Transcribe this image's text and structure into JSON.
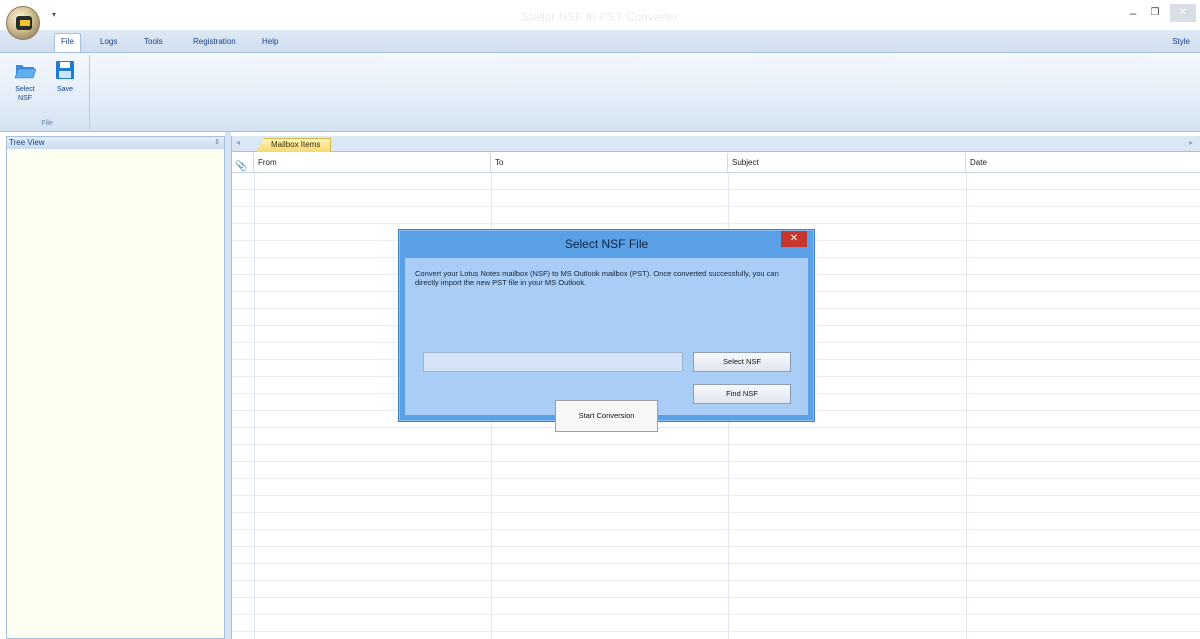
{
  "window": {
    "title": "Stellar NSF to PST Converter",
    "minimize_glyph": "–",
    "maximize_glyph": "❐",
    "close_glyph": "✕",
    "qat_glyph": "▾"
  },
  "ribbon": {
    "tabs": [
      {
        "label": "File",
        "active": true
      },
      {
        "label": "Logs",
        "active": false
      },
      {
        "label": "Tools",
        "active": false
      },
      {
        "label": "Registration",
        "active": false
      },
      {
        "label": "Help",
        "active": false
      }
    ],
    "style_label": "Style",
    "groups": [
      {
        "label": "File",
        "buttons": [
          {
            "label": "Select NSF",
            "icon": "folder-open-icon"
          },
          {
            "label": "Save",
            "icon": "floppy-disk-icon"
          }
        ]
      }
    ]
  },
  "tree_view": {
    "title": "Tree View",
    "pin_glyph": "⇕"
  },
  "mailbox": {
    "tab_label": "Mailbox Items",
    "nav_left": "◂",
    "nav_right": "▸",
    "attachment_icon": "📎",
    "columns": [
      "From",
      "To",
      "Subject",
      "Date"
    ]
  },
  "dialog": {
    "title": "Select NSF File",
    "close_glyph": "✕",
    "message": "Convert your Lotus Notes mailbox (NSF) to MS Outlook mailbox (PST). Once converted successfully, you can directly import the new PST file in your MS Outlook.",
    "path_value": "",
    "select_button": "Select NSF",
    "find_button": "Find NSF",
    "start_button": "Start Conversion"
  },
  "colors": {
    "dialog_frame": "#5aa0e6",
    "dialog_body": "#a9cdf5",
    "close_red": "#c7362c",
    "active_doc_tab": "#f8d870"
  }
}
